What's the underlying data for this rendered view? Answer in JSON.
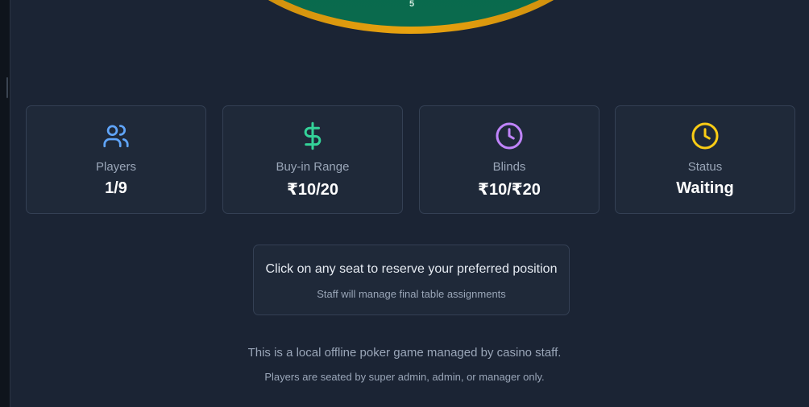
{
  "table": {
    "seat_number": "5",
    "felt_color": "#046b4b",
    "rail_color": "#e8a20f"
  },
  "stats": [
    {
      "icon": "users-icon",
      "color": "#60a5fa",
      "label": "Players",
      "value": "1/9"
    },
    {
      "icon": "dollar-icon",
      "color": "#34d399",
      "label": "Buy-in Range",
      "value": "₹10/20"
    },
    {
      "icon": "clock-icon",
      "color": "#c084fc",
      "label": "Blinds",
      "value": "₹10/₹20"
    },
    {
      "icon": "clock-icon",
      "color": "#facc15",
      "label": "Status",
      "value": "Waiting"
    }
  ],
  "info": {
    "main": "Click on any seat to reserve your preferred position",
    "sub": "Staff will manage final table assignments"
  },
  "footer": {
    "line1": "This is a local offline poker game managed by casino staff.",
    "line2": "Players are seated by super admin, admin, or manager only."
  }
}
